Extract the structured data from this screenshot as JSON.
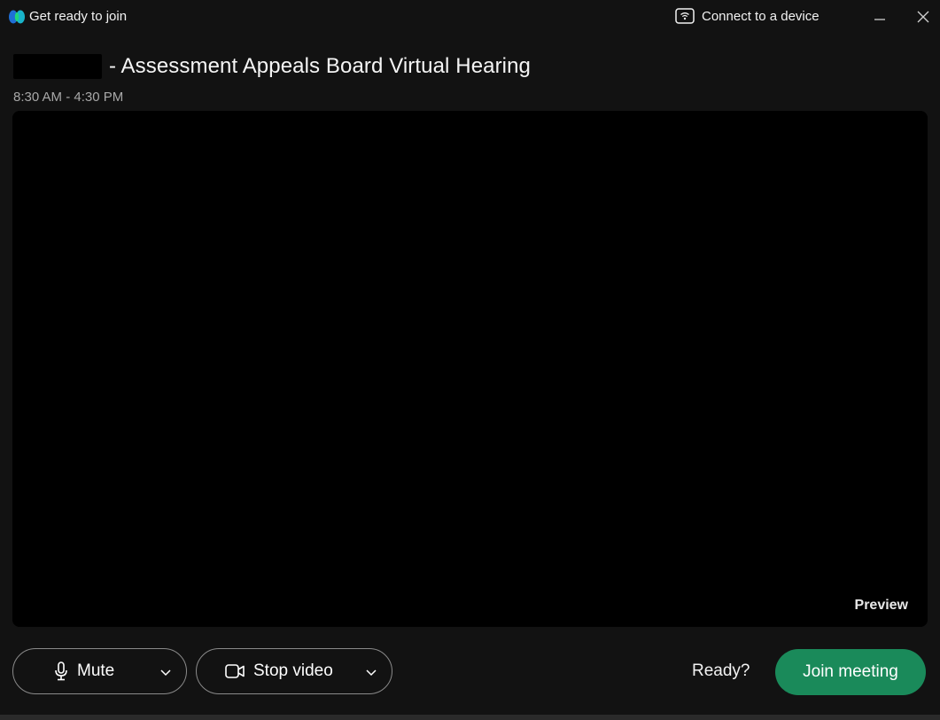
{
  "titlebar": {
    "title": "Get ready to join",
    "connect_device_label": "Connect to a device",
    "logo_icon": "webex-logo-icon",
    "device_icon": "device-connect-icon"
  },
  "meeting": {
    "title": "- Assessment Appeals Board Virtual Hearing",
    "time": "8:30 AM - 4:30 PM"
  },
  "preview": {
    "label": "Preview"
  },
  "controls": {
    "mute_label": "Mute",
    "stop_video_label": "Stop video",
    "ready_label": "Ready?",
    "join_label": "Join meeting"
  },
  "colors": {
    "background": "#121212",
    "preview": "#000000",
    "join_button": "#1a8a5a",
    "pill_border": "#8a8a8a"
  }
}
